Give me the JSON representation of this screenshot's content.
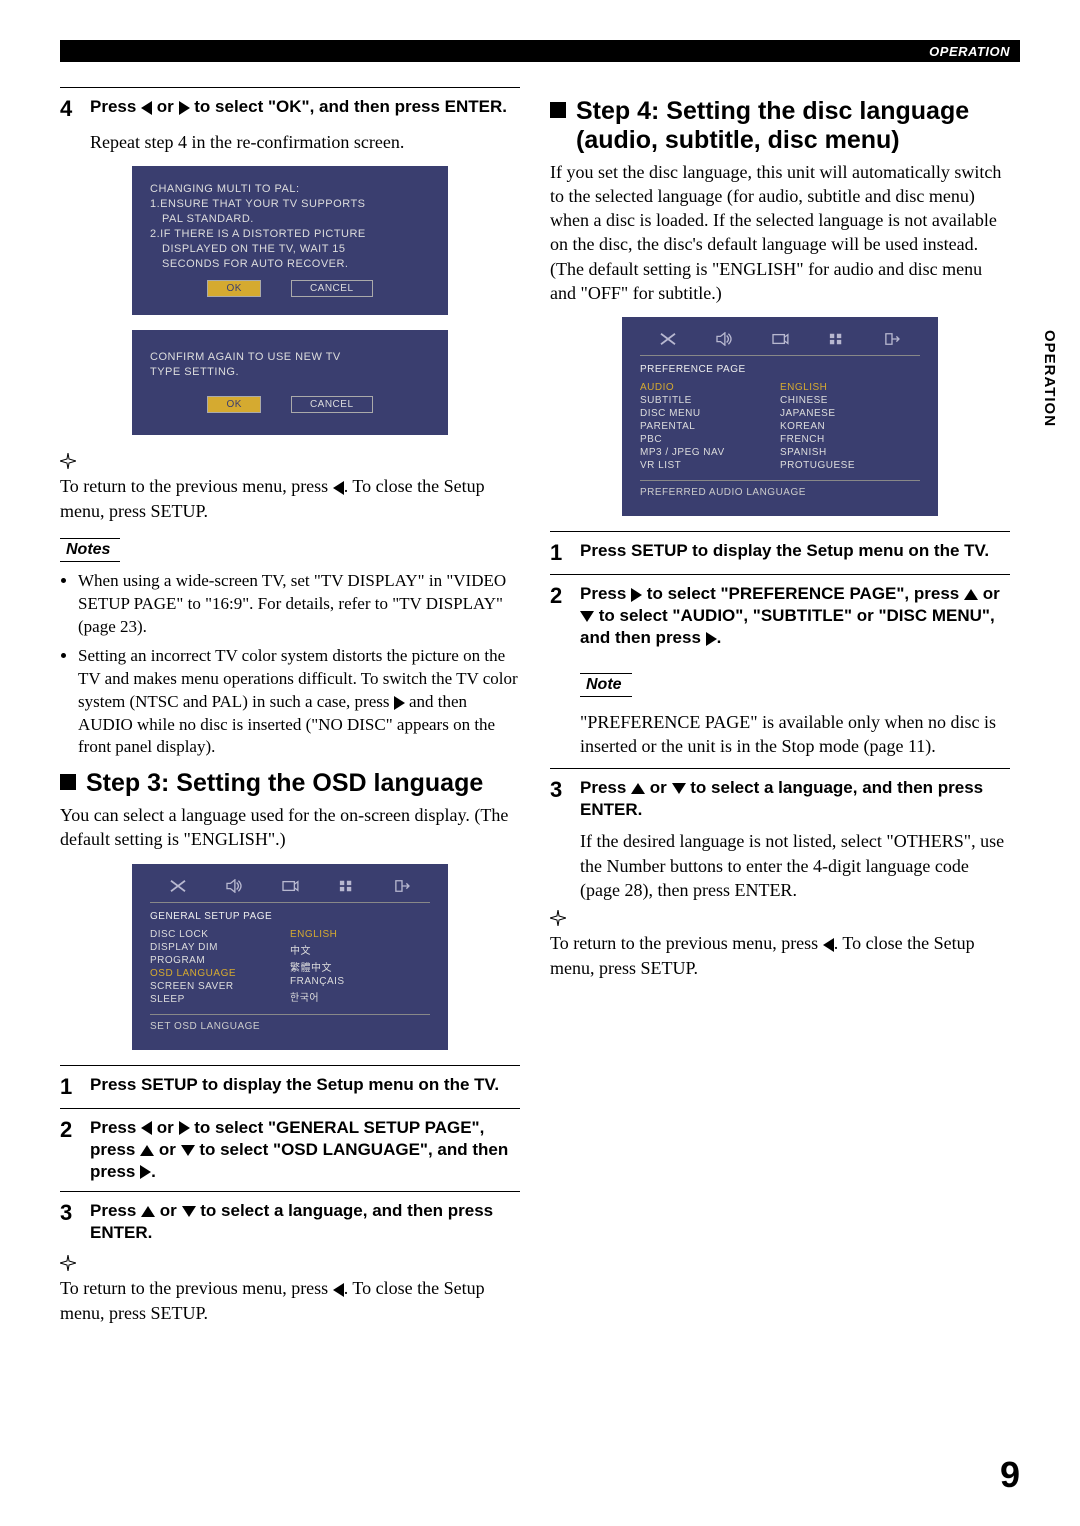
{
  "header": {
    "section": "OPERATION"
  },
  "side_tab": "OPERATION",
  "left": {
    "step4": {
      "num": "4",
      "title_a": "Press",
      "title_b": "or",
      "title_c": "to select \"OK\", and then press ENTER.",
      "body": "Repeat step 4 in the re-confirmation screen."
    },
    "osd1": {
      "t1": "CHANGING MULTI TO PAL:",
      "t2": "1.ENSURE THAT YOUR TV SUPPORTS",
      "t3": "PAL STANDARD.",
      "t4": "2.IF THERE IS A DISTORTED PICTURE",
      "t5": "DISPLAYED ON THE TV, WAIT 15",
      "t6": "SECONDS FOR AUTO RECOVER.",
      "ok": "OK",
      "cancel": "CANCEL"
    },
    "osd2": {
      "t1": "CONFIRM AGAIN TO USE NEW TV",
      "t2": "TYPE SETTING.",
      "ok": "OK",
      "cancel": "CANCEL"
    },
    "tip1": {
      "a": "To return to the previous menu, press",
      "b": ". To close the Setup menu, press SETUP."
    },
    "notes_label": "Notes",
    "note1": "When using a wide-screen TV, set \"TV DISPLAY\" in \"VIDEO SETUP PAGE\" to \"16:9\". For details, refer to \"TV DISPLAY\" (page 23).",
    "note2a": "Setting an incorrect TV color system distorts the picture on the TV and makes menu operations difficult. To switch the TV color system (NTSC and PAL) in such a case, press",
    "note2b": "and then AUDIO while no disc is inserted (\"NO DISC\" appears on the front panel display).",
    "step3_heading": "Step 3: Setting the OSD language",
    "step3_intro": "You can select a language used for the on-screen display. (The default setting is \"ENGLISH\".)",
    "osd3": {
      "title": "GENERAL SETUP PAGE",
      "items_l": [
        "DISC LOCK",
        "DISPLAY DIM",
        "PROGRAM",
        "OSD LANGUAGE",
        "SCREEN SAVER",
        "SLEEP"
      ],
      "items_r": [
        "ENGLISH",
        "中文",
        "繁體中文",
        "FRANÇAIS",
        "한국어"
      ],
      "footer": "SET OSD LANGUAGE"
    },
    "s3_1": {
      "num": "1",
      "text": "Press SETUP to display the Setup menu on the TV."
    },
    "s3_2": {
      "num": "2",
      "a": "Press",
      "b": "or",
      "c": "to select \"GENERAL SETUP PAGE\", press",
      "d": "or",
      "e": "to select \"OSD LANGUAGE\", and then press",
      "f": "."
    },
    "s3_3": {
      "num": "3",
      "a": "Press",
      "b": "or",
      "c": "to select a language, and then press ENTER."
    },
    "tip3": {
      "a": "To return to the previous menu, press",
      "b": ". To close the Setup menu, press SETUP."
    }
  },
  "right": {
    "step4_heading": "Step 4: Setting the disc language (audio, subtitle, disc menu)",
    "intro": "If you set the disc language, this unit will automatically switch to the selected language (for audio, subtitle and disc menu) when a disc is loaded. If the selected language is not available on the disc, the disc's default language will be used instead. (The default setting is \"ENGLISH\" for audio and disc menu and \"OFF\" for subtitle.)",
    "osd4": {
      "title": "PREFERENCE PAGE",
      "items_l": [
        "AUDIO",
        "SUBTITLE",
        "DISC MENU",
        "PARENTAL",
        "PBC",
        "MP3 / JPEG NAV",
        "VR LIST"
      ],
      "items_r": [
        "ENGLISH",
        "CHINESE",
        "JAPANESE",
        "KOREAN",
        "FRENCH",
        "SPANISH",
        "PROTUGUESE"
      ],
      "footer": "PREFERRED AUDIO LANGUAGE"
    },
    "s4_1": {
      "num": "1",
      "text": "Press SETUP to display the Setup menu on the TV."
    },
    "s4_2": {
      "num": "2",
      "a": "Press",
      "b": "to select \"PREFERENCE PAGE\", press",
      "c": "or",
      "d": "to select \"AUDIO\", \"SUBTITLE\" or \"DISC MENU\", and then press",
      "e": "."
    },
    "note_label": "Note",
    "note_text": "\"PREFERENCE PAGE\" is available only when no disc is inserted or the unit is in the Stop mode (page 11).",
    "s4_3": {
      "num": "3",
      "a": "Press",
      "b": "or",
      "c": "to select a language, and then press ENTER.",
      "body": "If the desired language is not listed, select \"OTHERS\", use the Number buttons to enter the 4-digit language code (page 28), then press ENTER."
    },
    "tip4": {
      "a": "To return to the previous menu, press",
      "b": ". To close the Setup menu, press SETUP."
    }
  },
  "page_num": "9"
}
